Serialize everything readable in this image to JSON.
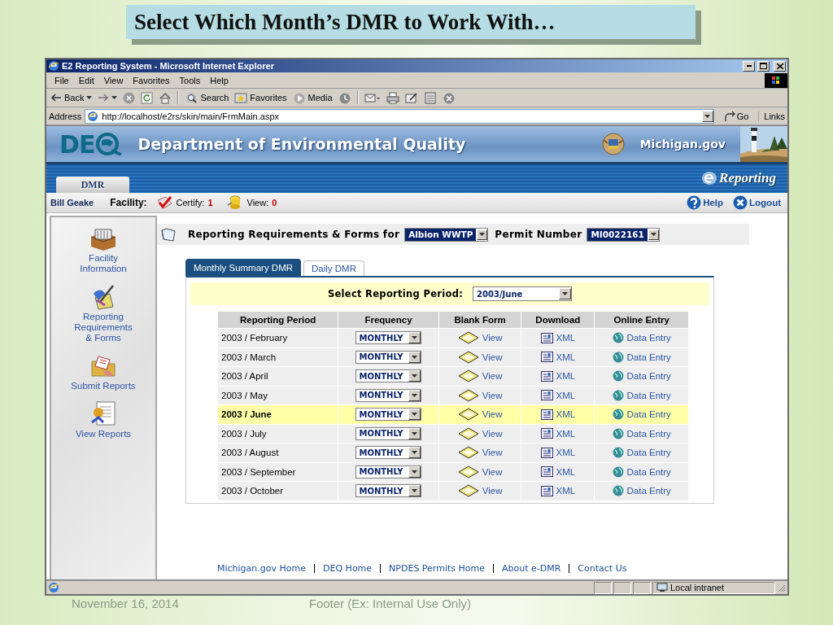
{
  "slide": {
    "title": "Select Which Month’s DMR to Work With…",
    "footer_date": "November 16, 2014",
    "footer_text": "Footer (Ex: Internal Use Only)"
  },
  "window": {
    "title": "E2 Reporting System - Microsoft Internet Explorer",
    "menu": [
      "File",
      "Edit",
      "View",
      "Favorites",
      "Tools",
      "Help"
    ],
    "toolbar": [
      {
        "kind": "back",
        "label": "Back"
      },
      {
        "kind": "forward"
      },
      {
        "kind": "stop"
      },
      {
        "kind": "refresh"
      },
      {
        "kind": "home"
      },
      {
        "kind": "search",
        "label": "Search"
      },
      {
        "kind": "favorites",
        "label": "Favorites"
      },
      {
        "kind": "media",
        "label": "Media"
      },
      {
        "kind": "history"
      },
      {
        "kind": "mail"
      },
      {
        "kind": "print"
      },
      {
        "kind": "edit"
      },
      {
        "kind": "discuss"
      },
      {
        "kind": "messenger"
      }
    ],
    "address": {
      "label": "Address",
      "value": "http://localhost/e2rs/skin/main/FrmMain.aspx"
    },
    "go": "Go",
    "links": "Links",
    "status_bar": {
      "zone": "Local intranet"
    }
  },
  "header": {
    "logo": "DE",
    "agency": "Department of Environmental Quality",
    "portal": "Michigan.gov",
    "brand": "Reporting",
    "tabs": [
      {
        "label": "DMR",
        "selected": true
      }
    ]
  },
  "userbar": {
    "user": "Bill Geake",
    "facility_label": "Facility:",
    "certify_label": "Certify:",
    "certify_count": "1",
    "view_label": "View:",
    "view_count": "0",
    "help": "Help",
    "logout": "Logout"
  },
  "sidebar": {
    "items": [
      {
        "kind": "facility",
        "label": "Facility Information"
      },
      {
        "kind": "requirements",
        "label": "Reporting Requirements & Forms"
      },
      {
        "kind": "submit",
        "label": "Submit Reports"
      },
      {
        "kind": "view",
        "label": "View Reports"
      }
    ]
  },
  "requirements": {
    "heading": "Reporting Requirements & Forms for",
    "facility": "Albion WWTP",
    "permit_label": "Permit Number",
    "permit": "MI0022161"
  },
  "tabs": [
    {
      "label": "Monthly Summary DMR",
      "selected": true
    },
    {
      "label": "Daily DMR",
      "selected": false
    }
  ],
  "period": {
    "label": "Select Reporting Period:",
    "value": "2003/June"
  },
  "table": {
    "columns": [
      "Reporting Period",
      "Frequency",
      "Blank Form",
      "Download",
      "Online Entry"
    ],
    "rows": [
      {
        "period": "2003 / February",
        "frequency": "MONTHLY",
        "blank_form": "View",
        "download": "XML",
        "online_entry": "Data Entry",
        "selected": false
      },
      {
        "period": "2003 / March",
        "frequency": "MONTHLY",
        "blank_form": "View",
        "download": "XML",
        "online_entry": "Data Entry",
        "selected": false
      },
      {
        "period": "2003 / April",
        "frequency": "MONTHLY",
        "blank_form": "View",
        "download": "XML",
        "online_entry": "Data Entry",
        "selected": false
      },
      {
        "period": "2003 / May",
        "frequency": "MONTHLY",
        "blank_form": "View",
        "download": "XML",
        "online_entry": "Data Entry",
        "selected": false
      },
      {
        "period": "2003 / June",
        "frequency": "MONTHLY",
        "blank_form": "View",
        "download": "XML",
        "online_entry": "Data Entry",
        "selected": true
      },
      {
        "period": "2003 / July",
        "frequency": "MONTHLY",
        "blank_form": "View",
        "download": "XML",
        "online_entry": "Data Entry",
        "selected": false
      },
      {
        "period": "2003 / August",
        "frequency": "MONTHLY",
        "blank_form": "View",
        "download": "XML",
        "online_entry": "Data Entry",
        "selected": false
      },
      {
        "period": "2003 / September",
        "frequency": "MONTHLY",
        "blank_form": "View",
        "download": "XML",
        "online_entry": "Data Entry",
        "selected": false
      },
      {
        "period": "2003 / October",
        "frequency": "MONTHLY",
        "blank_form": "View",
        "download": "XML",
        "online_entry": "Data Entry",
        "selected": false
      }
    ]
  },
  "footer_links": [
    "Michigan.gov Home",
    "DEQ Home",
    "NPDES Permits Home",
    "About e-DMR",
    "Contact Us"
  ]
}
